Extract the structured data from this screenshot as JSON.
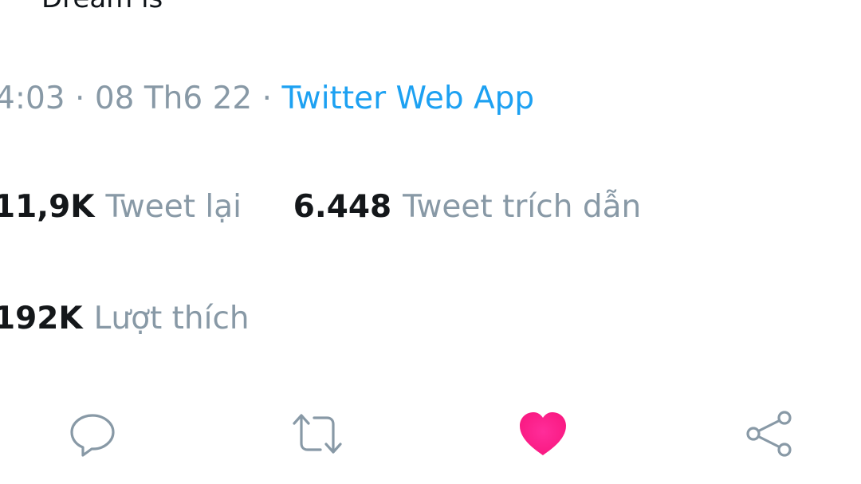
{
  "tweet": {
    "text_fragment": "Dream is"
  },
  "meta": {
    "time": "4:03",
    "separator": "·",
    "date": "08 Th6 22",
    "source": "Twitter Web App"
  },
  "stats": {
    "retweets": {
      "count": "11,9K",
      "label": "Tweet lại"
    },
    "quote_tweets": {
      "count": "6.448",
      "label": "Tweet trích dẫn"
    },
    "likes": {
      "count": "192K",
      "label": "Lượt thích"
    }
  },
  "actions": {
    "icons": [
      "reply-icon",
      "retweet-icon",
      "like-icon",
      "share-icon"
    ],
    "like_active": true,
    "colors": {
      "icon": "#8899a6",
      "like": "#f91880",
      "source_link": "#1da1f2",
      "count": "#14171a"
    }
  }
}
